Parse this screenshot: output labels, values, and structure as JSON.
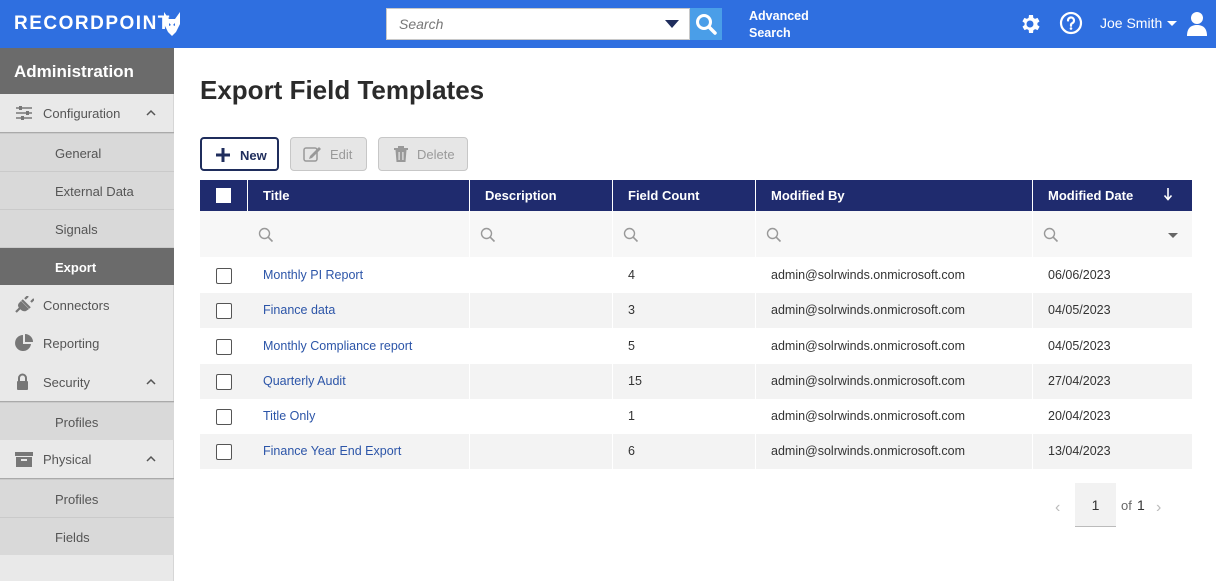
{
  "header": {
    "logo_text": "RECORDPOINT",
    "search_placeholder": "Search",
    "advanced_search_line1": "Advanced",
    "advanced_search_line2": "Search",
    "user_name": "Joe Smith"
  },
  "sidebar": {
    "title": "Administration",
    "sections": [
      {
        "label": "Configuration",
        "icon": "sliders-icon",
        "expanded": true,
        "children": [
          "General",
          "External Data",
          "Signals",
          "Export"
        ]
      },
      {
        "label": "Connectors",
        "icon": "plug-icon"
      },
      {
        "label": "Reporting",
        "icon": "pie-chart-icon"
      },
      {
        "label": "Security",
        "icon": "lock-icon",
        "expanded": true,
        "children": [
          "Profiles"
        ]
      },
      {
        "label": "Physical",
        "icon": "archive-box-icon",
        "expanded": true,
        "children": [
          "Profiles",
          "Fields"
        ]
      }
    ],
    "active_item": "Export"
  },
  "main": {
    "title": "Export Field Templates",
    "toolbar": {
      "new_label": "New",
      "edit_label": "Edit",
      "delete_label": "Delete"
    },
    "table": {
      "columns": [
        "Title",
        "Description",
        "Field Count",
        "Modified By",
        "Modified Date"
      ],
      "rows": [
        {
          "title": "Monthly PI Report",
          "description": "",
          "field_count": "4",
          "modified_by": "admin@solrwinds.onmicrosoft.com",
          "modified_date": "06/06/2023"
        },
        {
          "title": "Finance data",
          "description": "",
          "field_count": "3",
          "modified_by": "admin@solrwinds.onmicrosoft.com",
          "modified_date": "04/05/2023"
        },
        {
          "title": "Monthly Compliance report",
          "description": "",
          "field_count": "5",
          "modified_by": "admin@solrwinds.onmicrosoft.com",
          "modified_date": "04/05/2023"
        },
        {
          "title": "Quarterly Audit",
          "description": "",
          "field_count": "15",
          "modified_by": "admin@solrwinds.onmicrosoft.com",
          "modified_date": "27/04/2023"
        },
        {
          "title": "Title Only",
          "description": "",
          "field_count": "1",
          "modified_by": "admin@solrwinds.onmicrosoft.com",
          "modified_date": "20/04/2023"
        },
        {
          "title": "Finance Year End Export",
          "description": "",
          "field_count": "6",
          "modified_by": "admin@solrwinds.onmicrosoft.com",
          "modified_date": "13/04/2023"
        }
      ]
    },
    "pagination": {
      "current_page": "1",
      "of_label": "of",
      "total_pages": "1",
      "prev_glyph": "‹",
      "next_glyph": "›"
    }
  },
  "colors": {
    "topbar": "#2f6fe0",
    "table_header": "#1f2b6e",
    "link": "#2c55a8",
    "sidebar_active": "#6b6b6b"
  }
}
